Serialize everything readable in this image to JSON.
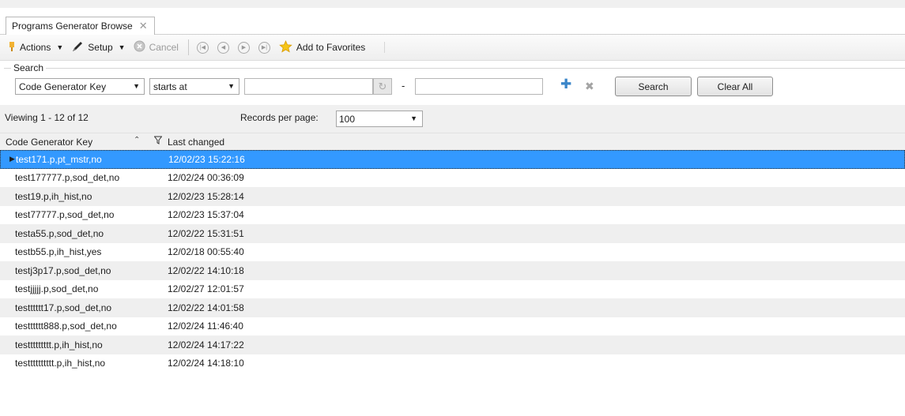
{
  "tab": {
    "title": "Programs Generator Browse",
    "close": "✕"
  },
  "toolbar": {
    "actions_label": "Actions",
    "setup_label": "Setup",
    "cancel_label": "Cancel",
    "favorites_label": "Add to Favorites",
    "icons": [
      "flag-icon",
      "pencil-icon",
      "cancel-icon",
      "first-icon",
      "prev-icon",
      "next-icon",
      "last-icon",
      "star-icon"
    ]
  },
  "search": {
    "legend": "Search",
    "field_value": "Code Generator Key",
    "operator_value": "starts at",
    "dash": "-",
    "search_button": "Search",
    "clear_button": "Clear All"
  },
  "paging": {
    "viewing_text": "Viewing 1 - 12 of 12",
    "records_label": "Records per page:",
    "records_value": "100"
  },
  "columns": {
    "col1": "Code Generator Key",
    "col2": "Last changed"
  },
  "rows": [
    {
      "key": "test171.p,pt_mstr,no",
      "changed": "12/02/23 15:22:16"
    },
    {
      "key": "test177777.p,sod_det,no",
      "changed": "12/02/24 00:36:09"
    },
    {
      "key": "test19.p,ih_hist,no",
      "changed": "12/02/23 15:28:14"
    },
    {
      "key": "test77777.p,sod_det,no",
      "changed": "12/02/23 15:37:04"
    },
    {
      "key": "testa55.p,sod_det,no",
      "changed": "12/02/22 15:31:51"
    },
    {
      "key": "testb55.p,ih_hist,yes",
      "changed": "12/02/18 00:55:40"
    },
    {
      "key": "testj3p17.p,sod_det,no",
      "changed": "12/02/22 14:10:18"
    },
    {
      "key": "testjjjjj.p,sod_det,no",
      "changed": "12/02/27 12:01:57"
    },
    {
      "key": "testttttt17.p,sod_det,no",
      "changed": "12/02/22 14:01:58"
    },
    {
      "key": "testttttt888.p,sod_det,no",
      "changed": "12/02/24 11:46:40"
    },
    {
      "key": "testtttttttt.p,ih_hist,no",
      "changed": "12/02/24 14:17:22"
    },
    {
      "key": "testttttttttt.p,ih_hist,no",
      "changed": "12/02/24 14:18:10"
    }
  ],
  "colors": {
    "selection": "#3399ff",
    "accent_plus": "#3b86c9"
  }
}
